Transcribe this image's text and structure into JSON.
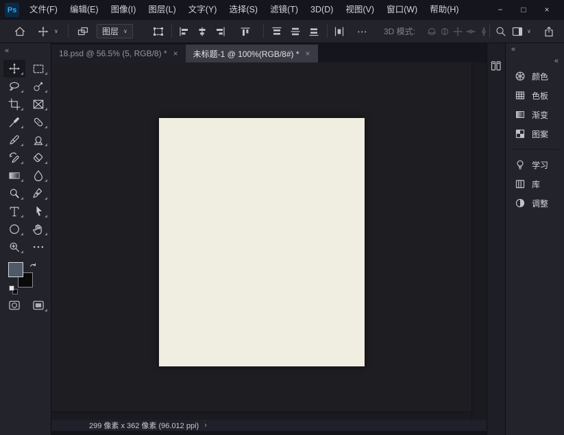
{
  "title_bar": {
    "app_icon_text": "Ps",
    "menus": [
      "文件(F)",
      "编辑(E)",
      "图像(I)",
      "图层(L)",
      "文字(Y)",
      "选择(S)",
      "滤镜(T)",
      "3D(D)",
      "视图(V)",
      "窗口(W)",
      "帮助(H)"
    ],
    "controls": {
      "minimize": "−",
      "maximize": "□",
      "close": "×"
    }
  },
  "options_bar": {
    "layer_select_label": "图层",
    "mode_3d_label": "3D 模式:",
    "more_label": "⋯"
  },
  "icons": {
    "collapse": "«",
    "chevron_down": "∨"
  },
  "tabs": [
    {
      "label": "18.psd @ 56.5% (5, RGB/8) *",
      "close": "×"
    },
    {
      "label": "未标题-1 @ 100%(RGB/8#) *",
      "close": "×"
    }
  ],
  "status_bar": {
    "text": "299 像素 x 362 像素 (96.012 ppi)",
    "chevron": "›"
  },
  "right_panels": {
    "groups": [
      {
        "items": [
          {
            "label": "颜色"
          },
          {
            "label": "色板"
          },
          {
            "label": "渐变"
          },
          {
            "label": "图案"
          }
        ]
      },
      {
        "items": [
          {
            "label": "学习"
          },
          {
            "label": "库"
          },
          {
            "label": "调整"
          }
        ]
      }
    ]
  },
  "colors": {
    "foreground_swatch": "#4e5a66",
    "background_swatch": "#0a0a0a",
    "document_fill": "#f0eee1",
    "app_accent_blue": "#31a8ff"
  }
}
